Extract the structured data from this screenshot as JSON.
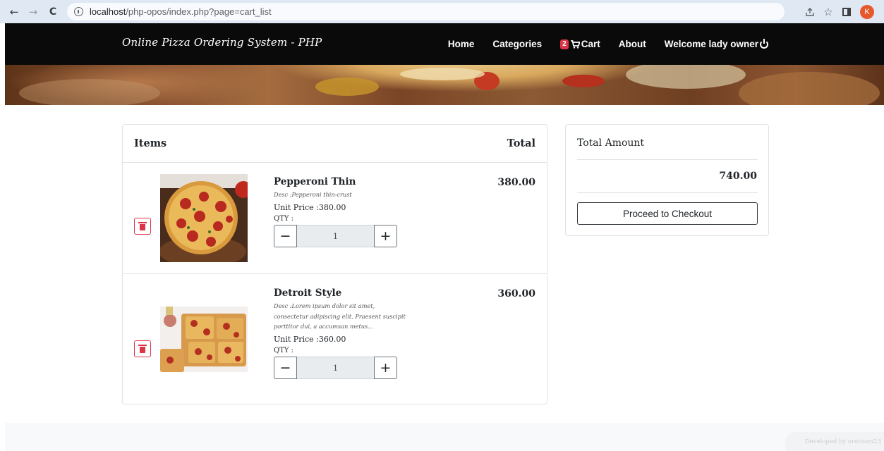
{
  "browser": {
    "url_host": "localhost",
    "url_path": "/php-opos/index.php?page=cart_list",
    "profile_initial": "K"
  },
  "site": {
    "brand": "Online Pizza Ordering System - PHP",
    "menu": {
      "home": "Home",
      "categories": "Categories",
      "cart_count": "2",
      "cart": "Cart",
      "about": "About",
      "welcome": "Welcome lady owner"
    }
  },
  "cart": {
    "header_items": "Items",
    "header_total": "Total",
    "items": [
      {
        "name": "Pepperoni Thin",
        "desc": "Desc :Pepperoni thin-crust",
        "unit_price": "Unit Price :380.00",
        "qty_label": "QTY :",
        "qty": "1",
        "total": "380.00"
      },
      {
        "name": "Detroit Style",
        "desc": "Desc :Lorem ipsum dolor sit amet, consectetur adipiscing elit. Praesent suscipit porttitor dui, a accumsan metus...",
        "unit_price": "Unit Price :360.00",
        "qty_label": "QTY :",
        "qty": "1",
        "total": "360.00"
      }
    ]
  },
  "summary": {
    "title": "Total Amount",
    "amount": "740.00",
    "checkout_label": "Proceed to Checkout"
  },
  "footer": {
    "credit": "Developed by oretnom23"
  },
  "colors": {
    "navbar": "#0a0a0a",
    "danger": "#dc3545",
    "browser_bar": "#dfe8f3"
  }
}
